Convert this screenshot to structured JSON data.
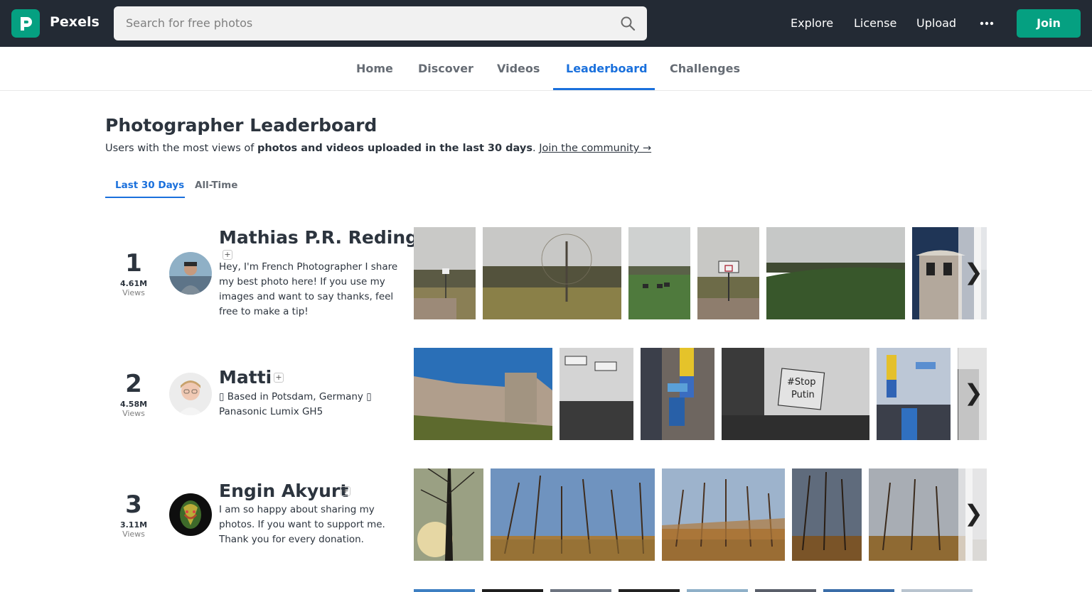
{
  "header": {
    "brand": "Pexels",
    "search_placeholder": "Search for free photos",
    "nav": [
      "Explore",
      "License",
      "Upload"
    ],
    "join_label": "Join",
    "accent": "#05a081",
    "bar_color": "#232a34"
  },
  "subnav": {
    "tabs": [
      "Home",
      "Discover",
      "Videos",
      "Leaderboard",
      "Challenges"
    ],
    "active": "Leaderboard",
    "active_color": "#1a70dc"
  },
  "page": {
    "title": "Photographer Leaderboard",
    "subtitle_prefix": "Users with the most views of ",
    "subtitle_bold": "photos and videos uploaded in the last 30 days",
    "subtitle_suffix": ". ",
    "subtitle_link": "Join the community →",
    "period_tabs": [
      "Last 30 Days",
      "All-Time"
    ],
    "period_active": "Last 30 Days"
  },
  "views_label": "Views",
  "follow_symbol": "+",
  "next_symbol": "❯",
  "leaders": [
    {
      "rank": "1",
      "views": "4.61M",
      "name": "Mathias P.R. Reding",
      "bio": "Hey, I'm French Photographer I share my best photo here! If you use my images and want to say thanks, feel free to make a tip!"
    },
    {
      "rank": "2",
      "views": "4.58M",
      "name": "Matti",
      "bio": "▯ Based in Potsdam, Germany ▯ Panasonic Lumix GH5"
    },
    {
      "rank": "3",
      "views": "3.11M",
      "name": "Engin Akyurt",
      "bio": "I am so happy about sharing my photos. If you want to support me. Thank you for every donation."
    }
  ]
}
